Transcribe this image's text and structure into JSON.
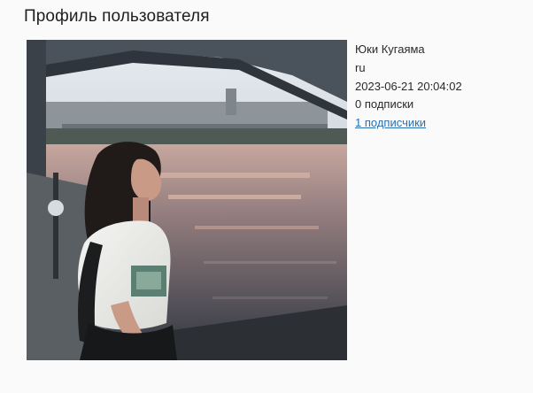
{
  "page": {
    "title": "Профиль пользователя"
  },
  "profile": {
    "photo_icon": "user-photo",
    "name": "Юки Кугаяма",
    "language": "ru",
    "registered": "2023-06-21 20:04:02",
    "following": "0 подписки",
    "followers_link": "1 подписчики"
  },
  "colors": {
    "link": "#2a6fb0",
    "text": "#2a2a2a",
    "background": "#fafafa"
  }
}
